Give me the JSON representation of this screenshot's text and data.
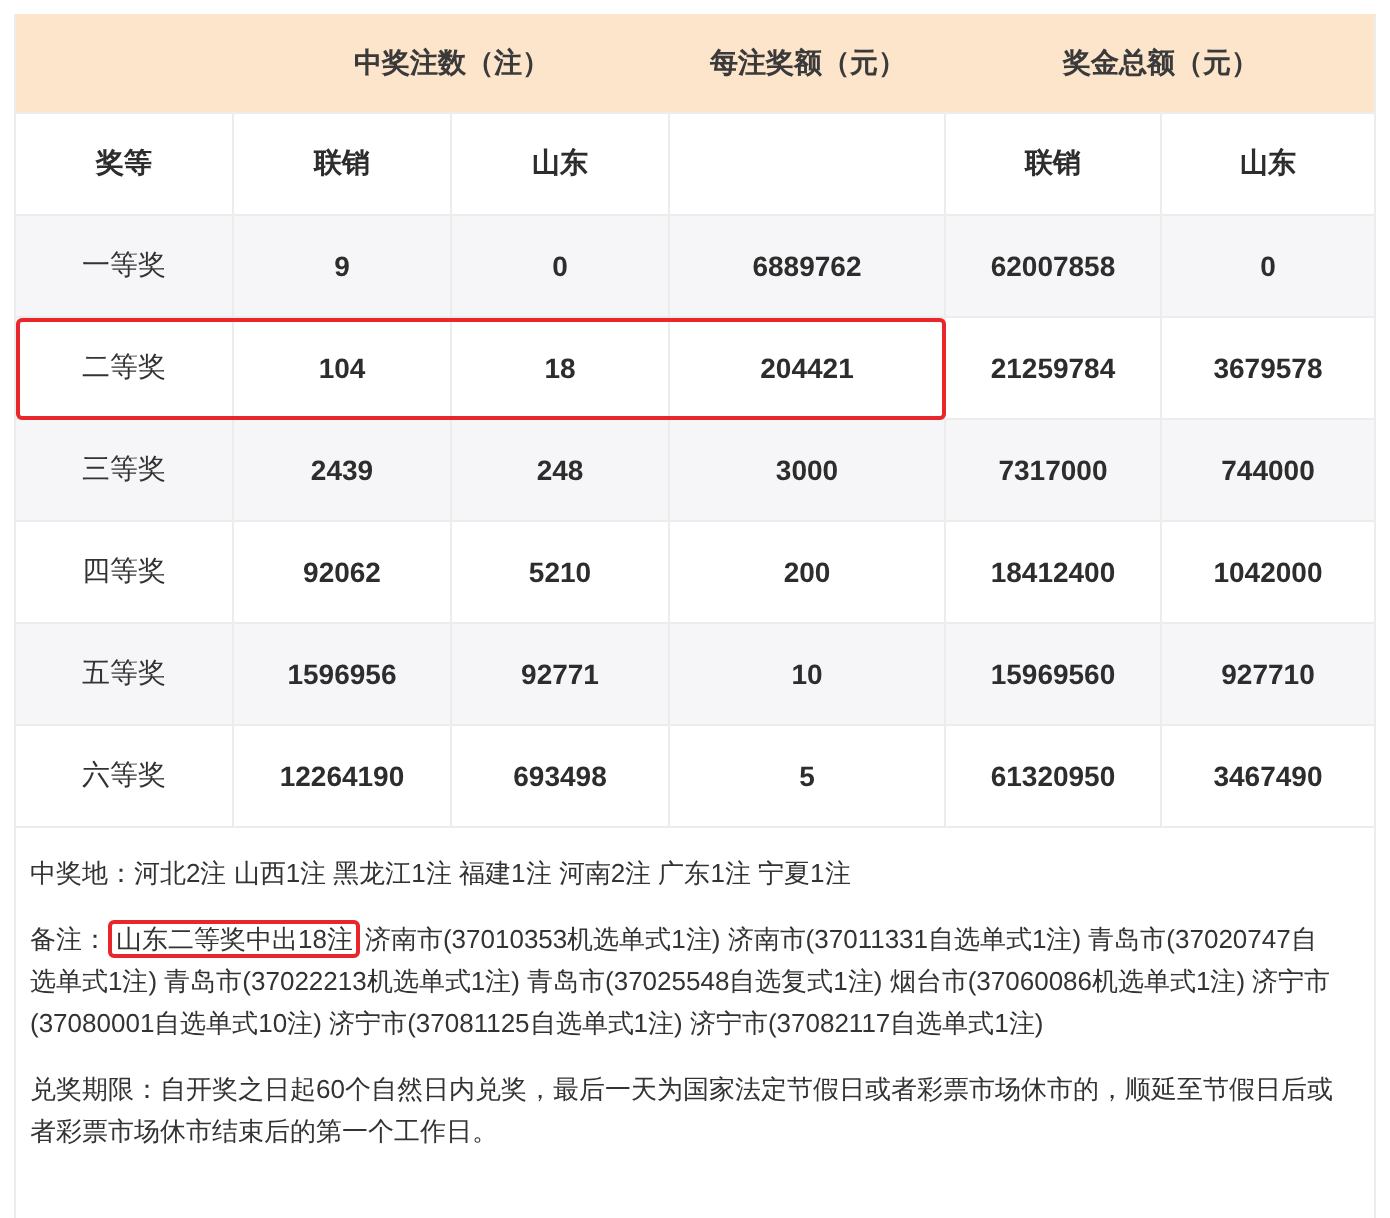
{
  "table": {
    "header_groups": [
      "中奖注数（注）",
      "每注奖额（元）",
      "奖金总额（元）"
    ],
    "subheaders": [
      {
        "kind": "text",
        "label": "奖等"
      },
      {
        "kind": "text",
        "label": "联销"
      },
      {
        "kind": "text",
        "label": "山东"
      },
      {
        "kind": "blank"
      },
      {
        "kind": "text",
        "label": "联销"
      },
      {
        "kind": "text",
        "label": "山东"
      }
    ],
    "rows": [
      {
        "prize": "一等奖",
        "values": [
          "9",
          "0",
          "6889762",
          "62007858",
          "0"
        ],
        "highlighted": false
      },
      {
        "prize": "二等奖",
        "values": [
          "104",
          "18",
          "204421",
          "21259784",
          "3679578"
        ],
        "highlighted": true
      },
      {
        "prize": "三等奖",
        "values": [
          "2439",
          "248",
          "3000",
          "7317000",
          "744000"
        ],
        "highlighted": false
      },
      {
        "prize": "四等奖",
        "values": [
          "92062",
          "5210",
          "200",
          "18412400",
          "1042000"
        ],
        "highlighted": false
      },
      {
        "prize": "五等奖",
        "values": [
          "1596956",
          "92771",
          "10",
          "15969560",
          "927710"
        ],
        "highlighted": false
      },
      {
        "prize": "六等奖",
        "values": [
          "12264190",
          "693498",
          "5",
          "61320950",
          "3467490"
        ],
        "highlighted": false
      }
    ]
  },
  "winners": "中奖地：河北2注 山西1注 黑龙江1注 福建1注 河南2注 广东1注 宁夏1注",
  "remark": {
    "label": "备注：",
    "segments": [
      {
        "text": "山东二等奖中出18注",
        "highlighted": true
      },
      {
        "text": "济南市(37010353机选单式1注) 济南市(37011331自选单式1注) 青岛市(37020747自选单式1注) 青岛市(37022213机选单式1注) 青岛市(37025548自选复式1注) 烟台市(37060086机选单式1注) 济宁市(37080001自选单式10注) 济宁市(37081125自选单式1注) 济宁市(37082117自选单式1注)",
        "highlighted": false
      }
    ]
  },
  "deadline": "兑奖期限：自开奖之日起60个自然日内兑奖，最后一天为国家法定节假日或者彩票市场休市的，顺延至节假日后或者彩票市场休市结束后的第一个工作日。"
}
